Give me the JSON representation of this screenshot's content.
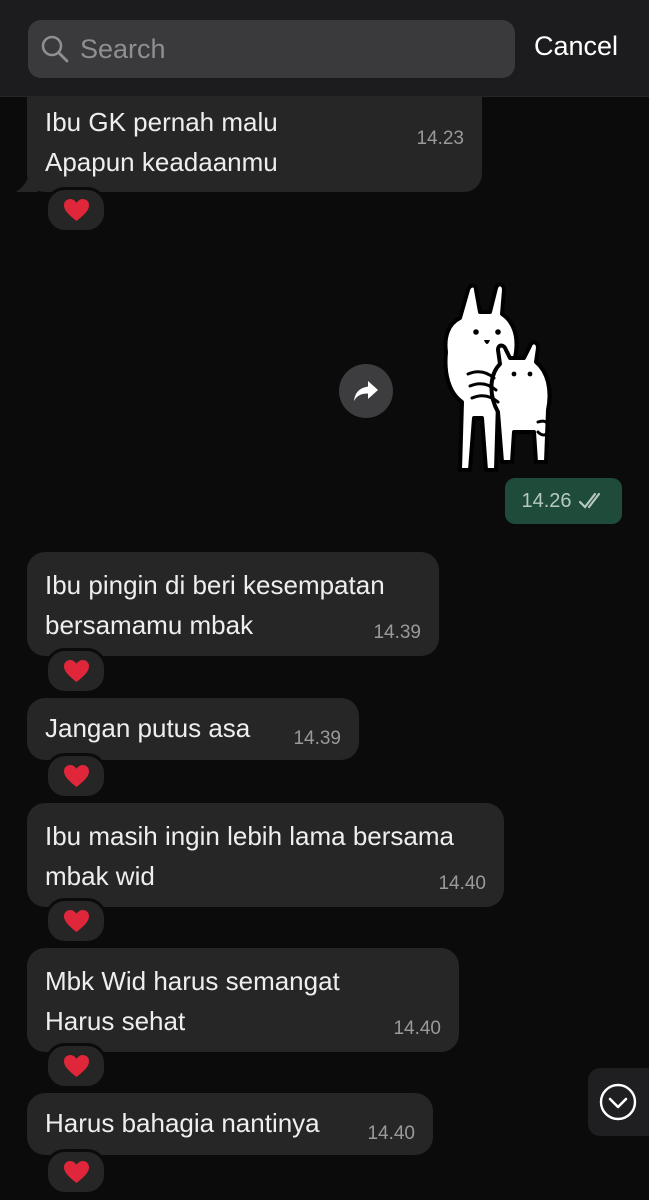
{
  "search": {
    "placeholder": "Search",
    "cancel_label": "Cancel"
  },
  "messages": [
    {
      "text": "Ibu GK pernah malu\nApapun keadaanmu",
      "time": "14.23",
      "reaction": "heart"
    },
    {
      "text": "Ibu pingin di beri kesempatan\nbersamamu mbak",
      "time": "14.39",
      "reaction": "heart"
    },
    {
      "text": "Jangan putus asa",
      "time": "14.39",
      "reaction": "heart"
    },
    {
      "text": "Ibu masih ingin lebih lama bersama\nmbak wid",
      "time": "14.40",
      "reaction": "heart"
    },
    {
      "text": "Mbk Wid harus semangat\nHarus sehat",
      "time": "14.40",
      "reaction": "heart"
    },
    {
      "text": "Harus bahagia nantinya",
      "time": "14.40",
      "reaction": "heart"
    }
  ],
  "sent_sticker": {
    "time": "14.26",
    "status": "read",
    "icon": "double-check-icon"
  },
  "colors": {
    "background": "#0b0b0b",
    "incoming_bubble": "#262626",
    "outgoing_bubble": "#1e4b3a",
    "heart": "#e0263b"
  }
}
